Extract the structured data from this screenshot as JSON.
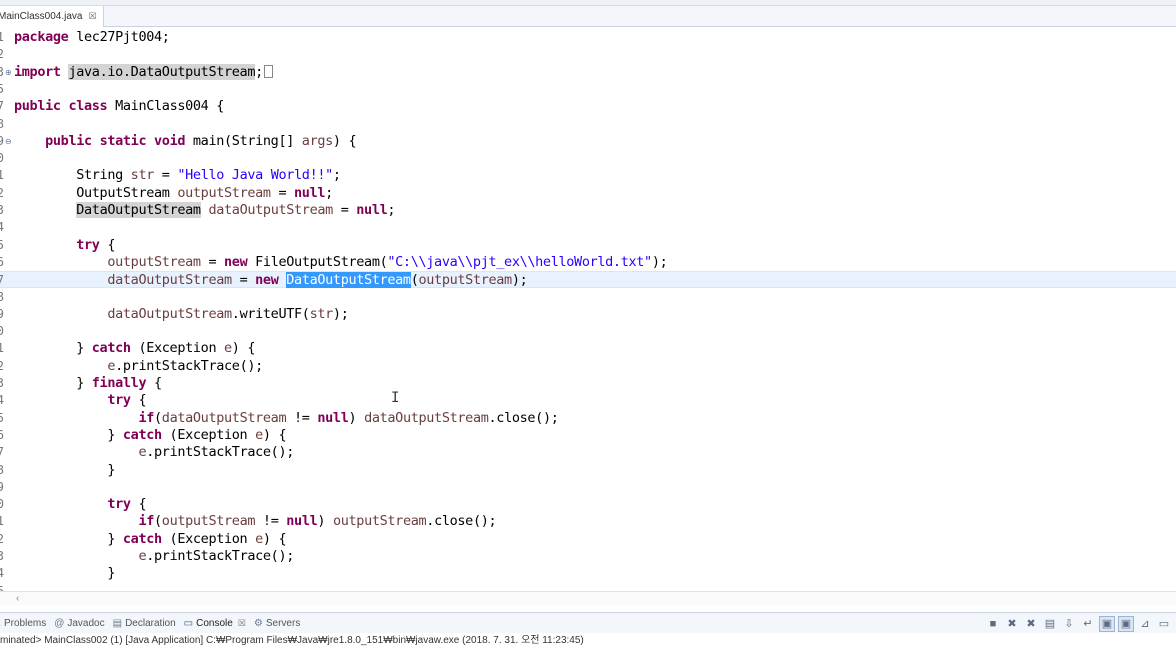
{
  "editor": {
    "tab_label": "MainClass004.java",
    "tab_close": "☒",
    "lines": [
      {
        "num": "1",
        "fold": "",
        "html": "<span class=\"kw\">package</span> lec27Pjt004;"
      },
      {
        "num": "2",
        "fold": "",
        "html": ""
      },
      {
        "num": "3",
        "fold": "⊕",
        "html": "<span class=\"kw\">import</span> <span class=\"occ\">java.io.DataOutputStream</span>;<span class=\"fold-box\"></span>"
      },
      {
        "num": "5",
        "fold": "",
        "html": ""
      },
      {
        "num": "7",
        "fold": "",
        "html": "<span class=\"kw\">public class</span> MainClass004 {"
      },
      {
        "num": "8",
        "fold": "",
        "html": ""
      },
      {
        "num": "9",
        "fold": "⊖",
        "html": "    <span class=\"kw\">public static void</span> main(String[] <span class=\"var\">args</span>) {"
      },
      {
        "num": "0",
        "fold": "",
        "html": ""
      },
      {
        "num": "1",
        "fold": "",
        "html": "        String <span class=\"var\">str</span> = <span class=\"str\">\"Hello Java World!!\"</span>;"
      },
      {
        "num": "2",
        "fold": "",
        "html": "        OutputStream <span class=\"var\">outputStream</span> = <span class=\"kw\">null</span>;"
      },
      {
        "num": "3",
        "fold": "",
        "html": "        <span class=\"occ\">DataOutputStream</span> <span class=\"var\">dataOutputStream</span> = <span class=\"kw\">null</span>;"
      },
      {
        "num": "4",
        "fold": "",
        "html": ""
      },
      {
        "num": "5",
        "fold": "",
        "html": "        <span class=\"kw\">try</span> {"
      },
      {
        "num": "6",
        "fold": "",
        "html": "            <span class=\"var\">outputStream</span> = <span class=\"kw\">new</span> FileOutputStream(<span class=\"str\">\"C:\\\\java\\\\pjt_ex\\\\helloWorld.txt\"</span>);"
      },
      {
        "num": "7",
        "fold": "",
        "html": "            <span class=\"var\">dataOutputStream</span> = <span class=\"kw\">new</span> <span class=\"sel\">DataOutputStream</span>(<span class=\"var\">outputStream</span>);",
        "current": true
      },
      {
        "num": "8",
        "fold": "",
        "html": ""
      },
      {
        "num": "9",
        "fold": "",
        "html": "            <span class=\"var\">dataOutputStream</span>.writeUTF(<span class=\"var\">str</span>);"
      },
      {
        "num": "0",
        "fold": "",
        "html": ""
      },
      {
        "num": "1",
        "fold": "",
        "html": "        } <span class=\"kw\">catch</span> (Exception <span class=\"var\">e</span>) {"
      },
      {
        "num": "2",
        "fold": "",
        "html": "            <span class=\"var\">e</span>.printStackTrace();"
      },
      {
        "num": "3",
        "fold": "",
        "html": "        } <span class=\"kw\">finally</span> {"
      },
      {
        "num": "4",
        "fold": "",
        "html": "            <span class=\"kw\">try</span> {"
      },
      {
        "num": "5",
        "fold": "",
        "html": "                <span class=\"kw\">if</span>(<span class=\"var\">dataOutputStream</span> != <span class=\"kw\">null</span>) <span class=\"var\">dataOutputStream</span>.close();"
      },
      {
        "num": "6",
        "fold": "",
        "html": "            } <span class=\"kw\">catch</span> (Exception <span class=\"var\">e</span>) {"
      },
      {
        "num": "7",
        "fold": "",
        "html": "                <span class=\"var\">e</span>.printStackTrace();"
      },
      {
        "num": "8",
        "fold": "",
        "html": "            }"
      },
      {
        "num": "9",
        "fold": "",
        "html": ""
      },
      {
        "num": "0",
        "fold": "",
        "html": "            <span class=\"kw\">try</span> {"
      },
      {
        "num": "1",
        "fold": "",
        "html": "                <span class=\"kw\">if</span>(<span class=\"var\">outputStream</span> != <span class=\"kw\">null</span>) <span class=\"var\">outputStream</span>.close();"
      },
      {
        "num": "2",
        "fold": "",
        "html": "            } <span class=\"kw\">catch</span> (Exception <span class=\"var\">e</span>) {"
      },
      {
        "num": "3",
        "fold": "",
        "html": "                <span class=\"var\">e</span>.printStackTrace();"
      },
      {
        "num": "4",
        "fold": "",
        "html": "            }"
      },
      {
        "num": "5",
        "fold": "",
        "html": ""
      }
    ]
  },
  "scrollbar": {
    "left_arrow": "‹"
  },
  "views": {
    "tabs": [
      {
        "name": "problems",
        "label": "Problems",
        "icon": "⚠",
        "active": false
      },
      {
        "name": "javadoc",
        "label": "Javadoc",
        "icon": "@",
        "active": false
      },
      {
        "name": "declaration",
        "label": "Declaration",
        "icon": "▤",
        "active": false
      },
      {
        "name": "console",
        "label": "Console",
        "icon": "▭",
        "active": true,
        "close": "☒"
      },
      {
        "name": "servers",
        "label": "Servers",
        "icon": "⚙",
        "active": false
      }
    ],
    "tools": [
      {
        "name": "terminate-icon",
        "glyph": "■",
        "pressed": false
      },
      {
        "name": "remove-launch-icon",
        "glyph": "✖",
        "pressed": false
      },
      {
        "name": "remove-all-icon",
        "glyph": "✖",
        "pressed": false
      },
      {
        "name": "clear-console-icon",
        "glyph": "▤",
        "pressed": false
      },
      {
        "name": "scroll-lock-icon",
        "glyph": "⇩",
        "pressed": false
      },
      {
        "name": "word-wrap-icon",
        "glyph": "↵",
        "pressed": false
      },
      {
        "name": "show-stdout-icon",
        "glyph": "▣",
        "pressed": true
      },
      {
        "name": "show-stderr-icon",
        "glyph": "▣",
        "pressed": true
      },
      {
        "name": "pin-console-icon",
        "glyph": "⊿",
        "pressed": false
      },
      {
        "name": "display-console-icon",
        "glyph": "▭",
        "pressed": false
      }
    ],
    "console_text": "minated> MainClass002 (1) [Java Application] C:₩Program Files₩Java₩jre1.8.0_151₩bin₩javaw.exe (2018. 7. 31. 오전 11:23:45)"
  }
}
